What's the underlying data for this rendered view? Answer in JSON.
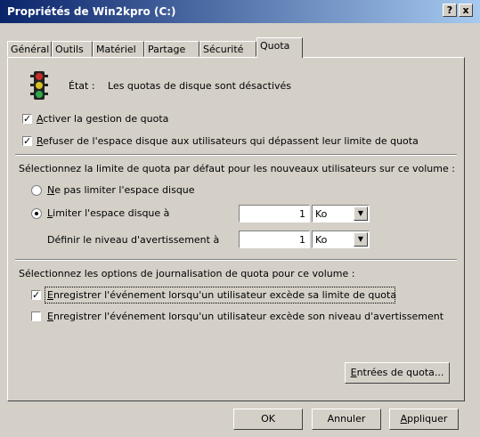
{
  "window": {
    "title": "Propriétés de Win2kpro (C:)",
    "help_label": "?",
    "close_label": "x"
  },
  "tabs": [
    {
      "label": "Général"
    },
    {
      "label": "Outils"
    },
    {
      "label": "Matériel"
    },
    {
      "label": "Partage"
    },
    {
      "label": "Sécurité"
    },
    {
      "label": "Quota"
    }
  ],
  "status": {
    "label": "État :",
    "text": "Les quotas de disque sont désactivés"
  },
  "options": {
    "enable_quota": {
      "label": "Activer la gestion de quota",
      "checked": true
    },
    "deny_space": {
      "label": "Refuser de l'espace disque aux utilisateurs qui dépassent leur limite de quota",
      "checked": true
    }
  },
  "limit_section": {
    "heading": "Sélectionnez la limite de quota par défaut pour les nouveaux utilisateurs sur ce volume :",
    "no_limit_label": "Ne pas limiter l'espace disque",
    "limit_label": "Limiter l'espace disque à",
    "limit_value": "1",
    "limit_unit": "Ko",
    "warning_label": "Définir le niveau d'avertissement à",
    "warning_value": "1",
    "warning_unit": "Ko",
    "selected": "limit"
  },
  "log_section": {
    "heading": "Sélectionnez les options de journalisation de quota pour ce volume :",
    "log_over_limit": {
      "label": "Enregistrer l'événement lorsqu'un utilisateur excède sa limite de quota",
      "checked": true
    },
    "log_over_warning": {
      "label": "Enregistrer l'événement lorsqu'un utilisateur excède son niveau d'avertissement",
      "checked": false
    }
  },
  "entries_button": "Entrées de quota...",
  "footer": {
    "ok": "OK",
    "cancel": "Annuler",
    "apply": "Appliquer"
  }
}
